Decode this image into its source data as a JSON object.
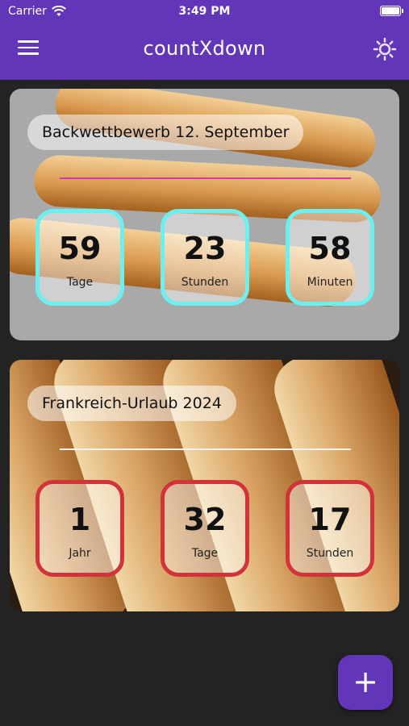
{
  "status_bar": {
    "carrier": "Carrier",
    "time": "3:49 PM"
  },
  "app_bar": {
    "title": "countXdown",
    "menu_icon": "hamburger-menu-icon",
    "theme_icon": "sun-icon"
  },
  "countdowns": [
    {
      "title": "Backwettbewerb 12. September",
      "accent": "#6cf0ef",
      "divider_color": "#d43aa6",
      "units": [
        {
          "value": "59",
          "label": "Tage"
        },
        {
          "value": "23",
          "label": "Stunden"
        },
        {
          "value": "58",
          "label": "Minuten"
        }
      ]
    },
    {
      "title": "Frankreich-Urlaub 2024",
      "accent": "#d2333b",
      "divider_color": "#f2f2f2",
      "units": [
        {
          "value": "1",
          "label": "Jahr"
        },
        {
          "value": "32",
          "label": "Tage"
        },
        {
          "value": "17",
          "label": "Stunden"
        }
      ]
    }
  ],
  "fab": {
    "label": "+",
    "icon": "plus-icon"
  },
  "colors": {
    "primary": "#6236b8",
    "background": "#232323"
  }
}
